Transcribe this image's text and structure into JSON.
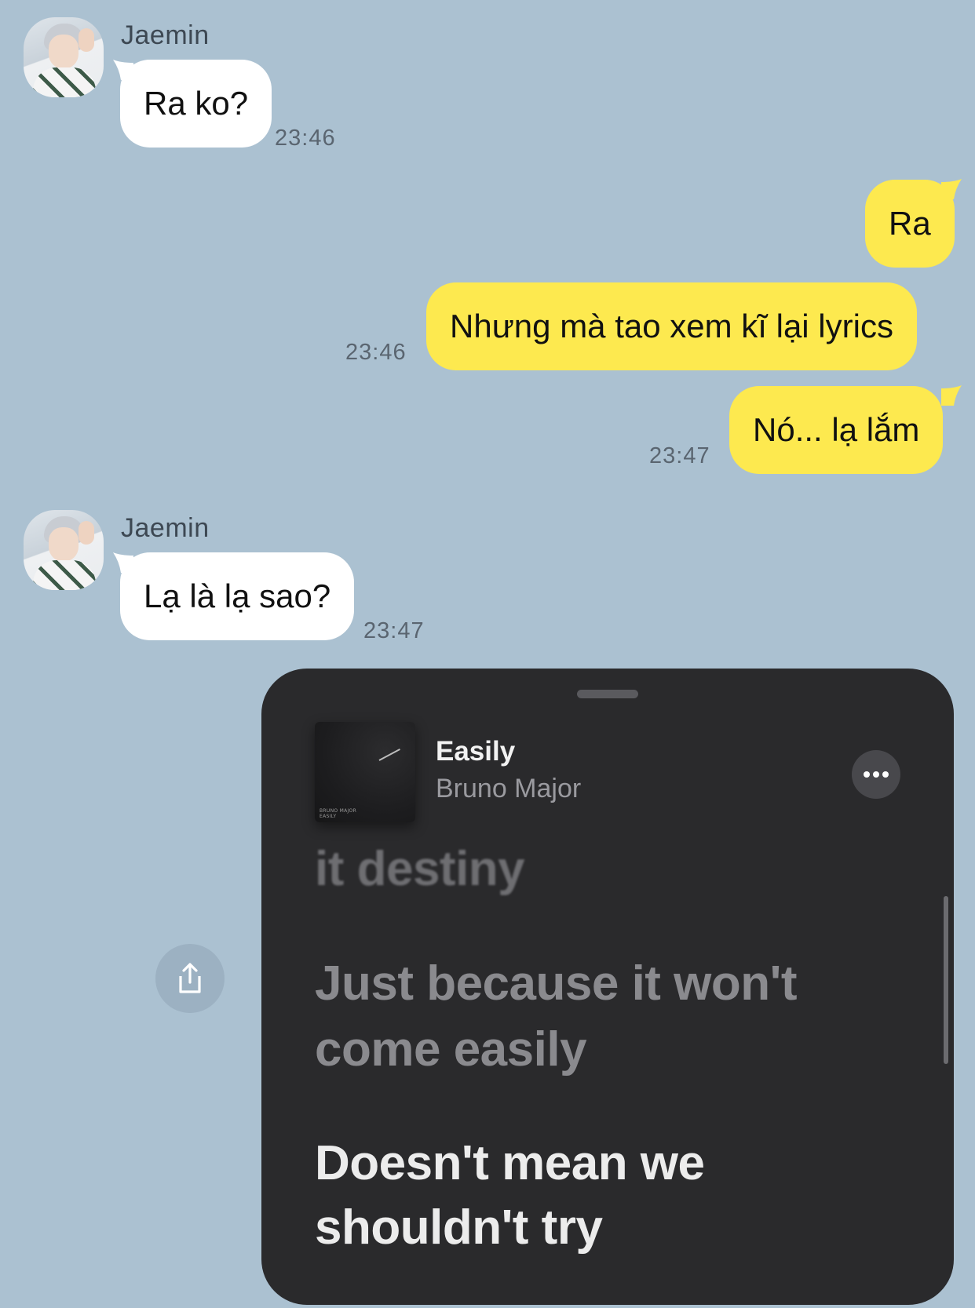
{
  "messages": [
    {
      "sender": "Jaemin",
      "text": "Ra ko?",
      "time": "23:46",
      "direction": "incoming"
    },
    {
      "text": "Ra",
      "direction": "outgoing"
    },
    {
      "text": "Nhưng mà tao xem kĩ lại lyrics",
      "time": "23:46",
      "direction": "outgoing"
    },
    {
      "text": "Nó... lạ lắm",
      "time": "23:47",
      "direction": "outgoing"
    },
    {
      "sender": "Jaemin",
      "text": "Lạ là lạ sao?",
      "time": "23:47",
      "direction": "incoming"
    }
  ],
  "music_card": {
    "album_cover_text": "BRUNO MAJOR\nEASILY",
    "song_title": "Easily",
    "artist": "Bruno Major",
    "lyrics": {
      "faded_line": "it destiny",
      "previous_line": "Just because it won't come easily",
      "current_line": "Doesn't mean we shouldn't try"
    }
  },
  "colors": {
    "background": "#abc1d1",
    "incoming_bubble": "#ffffff",
    "outgoing_bubble": "#fde94f",
    "card_background": "#2a2a2c"
  },
  "icons": {
    "share": "share-icon",
    "more": "more-icon"
  }
}
